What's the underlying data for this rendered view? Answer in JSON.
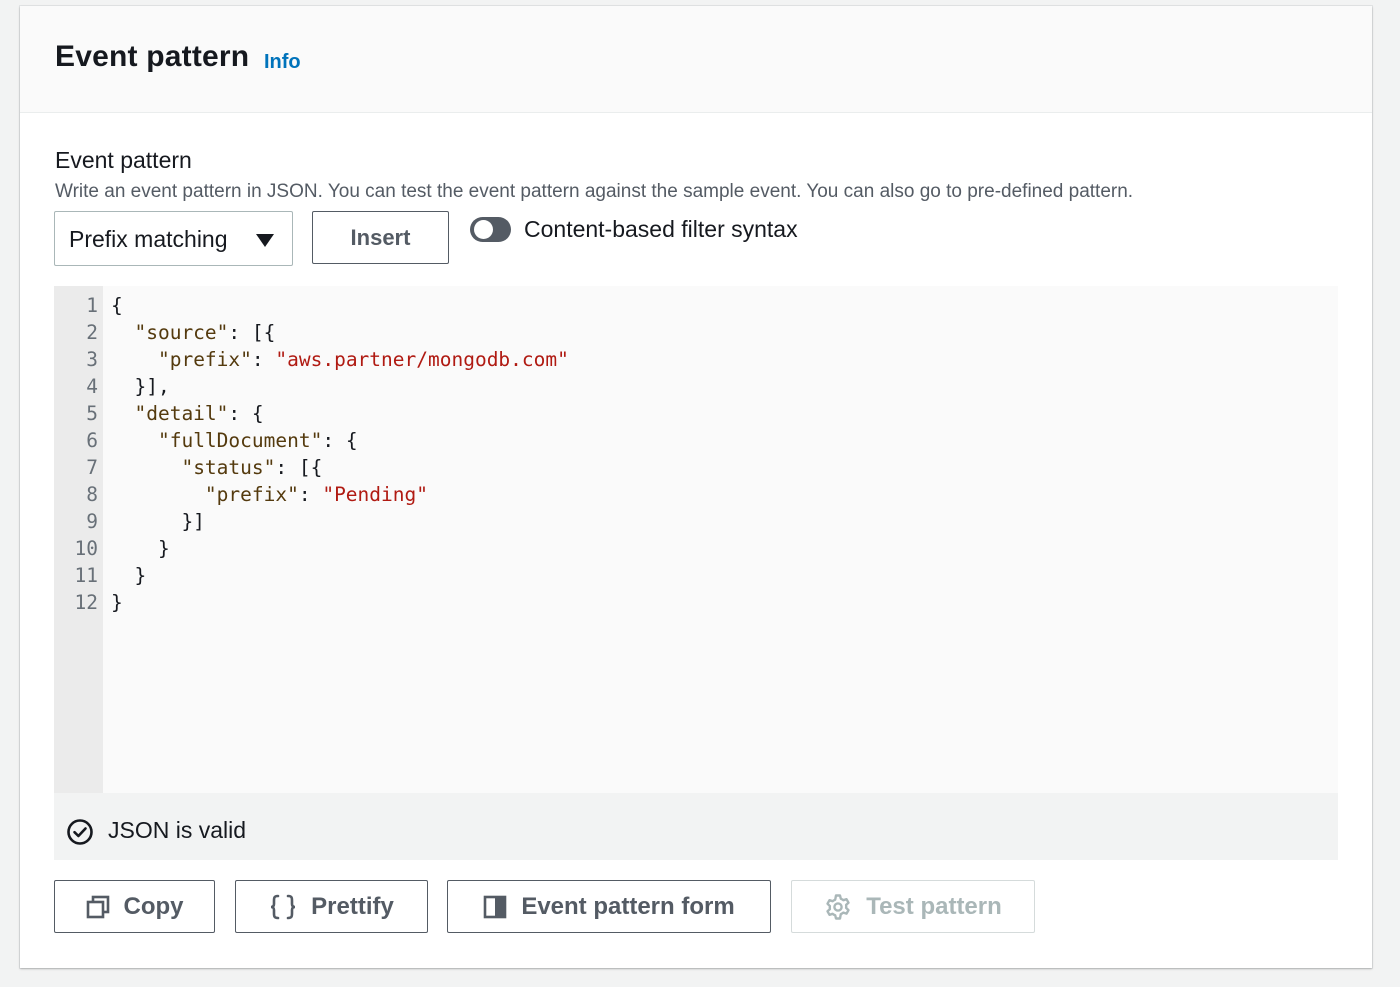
{
  "header": {
    "title": "Event pattern",
    "info_link": "Info"
  },
  "field": {
    "label": "Event pattern",
    "description": "Write an event pattern in JSON. You can test the event pattern against the sample event. You can also go to pre-defined pattern."
  },
  "controls": {
    "select_value": "Prefix matching",
    "insert_label": "Insert",
    "toggle_label": "Content-based filter syntax",
    "toggle_on": false
  },
  "editor": {
    "line_numbers": [
      "1",
      "2",
      "3",
      "4",
      "5",
      "6",
      "7",
      "8",
      "9",
      "10",
      "11",
      "12"
    ],
    "lines": [
      [
        {
          "t": "p",
          "v": "{"
        }
      ],
      [
        {
          "t": "p",
          "v": "  "
        },
        {
          "t": "k",
          "v": "\"source\""
        },
        {
          "t": "p",
          "v": ": [{"
        }
      ],
      [
        {
          "t": "p",
          "v": "    "
        },
        {
          "t": "k",
          "v": "\"prefix\""
        },
        {
          "t": "p",
          "v": ": "
        },
        {
          "t": "s",
          "v": "\"aws.partner/mongodb.com\""
        }
      ],
      [
        {
          "t": "p",
          "v": "  }],"
        }
      ],
      [
        {
          "t": "p",
          "v": "  "
        },
        {
          "t": "k",
          "v": "\"detail\""
        },
        {
          "t": "p",
          "v": ": {"
        }
      ],
      [
        {
          "t": "p",
          "v": "    "
        },
        {
          "t": "k",
          "v": "\"fullDocument\""
        },
        {
          "t": "p",
          "v": ": {"
        }
      ],
      [
        {
          "t": "p",
          "v": "      "
        },
        {
          "t": "k",
          "v": "\"status\""
        },
        {
          "t": "p",
          "v": ": [{"
        }
      ],
      [
        {
          "t": "p",
          "v": "        "
        },
        {
          "t": "k",
          "v": "\"prefix\""
        },
        {
          "t": "p",
          "v": ": "
        },
        {
          "t": "s",
          "v": "\"Pending\""
        }
      ],
      [
        {
          "t": "p",
          "v": "      }]"
        }
      ],
      [
        {
          "t": "p",
          "v": "    }"
        }
      ],
      [
        {
          "t": "p",
          "v": "  }"
        }
      ],
      [
        {
          "t": "p",
          "v": "}"
        }
      ]
    ],
    "status_text": "JSON is valid",
    "status_icon": "check-circle-icon"
  },
  "actions": {
    "copy_label": "Copy",
    "prettify_label": "Prettify",
    "form_label": "Event pattern form",
    "test_label": "Test pattern"
  },
  "colors": {
    "accent": "#0073bb",
    "json_key": "#543a0e",
    "json_string": "#b01a12",
    "toggle_off": "#545b64",
    "disabled": "#aab7b8"
  }
}
